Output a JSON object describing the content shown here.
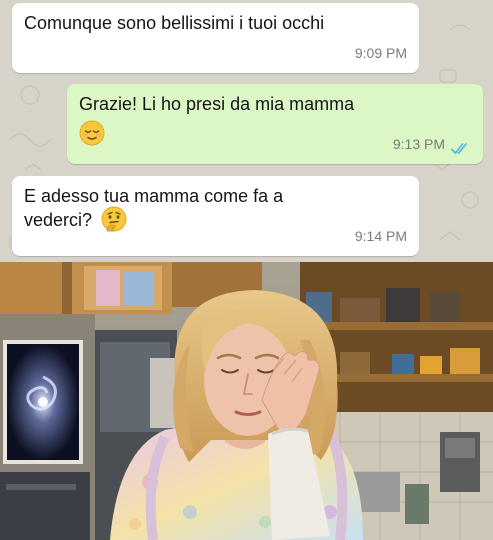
{
  "messages": [
    {
      "direction": "incoming",
      "text": "Comunque sono bellissimi i tuoi occhi",
      "time": "9:09 PM"
    },
    {
      "direction": "outgoing",
      "text": "Grazie! Li ho presi da mia mamma",
      "emoji": "relieved-face-emoji",
      "time": "9:13 PM",
      "status": "read-double-check"
    },
    {
      "direction": "incoming",
      "text": "E adesso tua mamma come fa a vederci?",
      "emoji": "thinking-face-emoji",
      "time": "9:14 PM"
    }
  ],
  "colors": {
    "chat_background": "#d8d3c8",
    "incoming_bubble": "#ffffff",
    "outgoing_bubble": "#dcf7c6",
    "read_tick": "#4fb6ec",
    "time_text": "#7b7b7b"
  },
  "photo": {
    "subject": "facepalm-reaction-photo"
  }
}
